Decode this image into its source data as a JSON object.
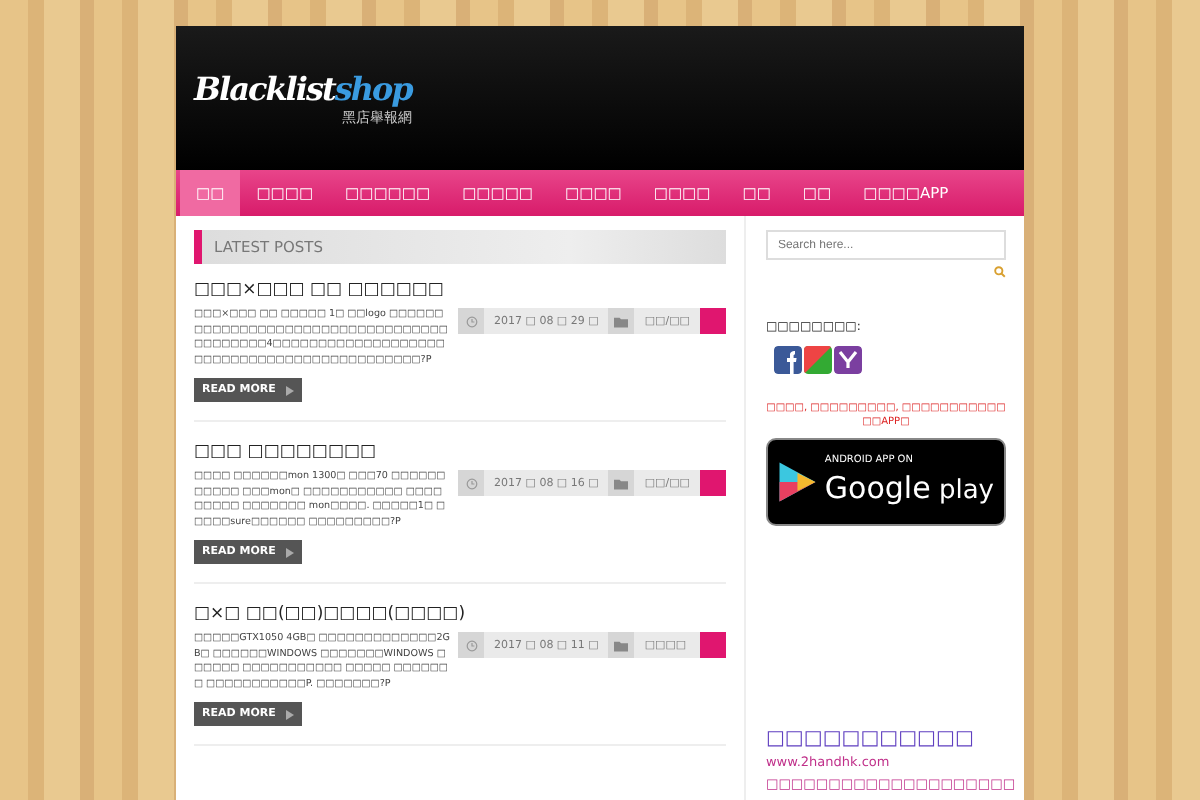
{
  "logo": {
    "main": "Blacklist",
    "accent": "shop",
    "subtitle": "黑店舉報網"
  },
  "nav": [
    {
      "label": "□□",
      "selected": true
    },
    {
      "label": "□□□□",
      "selected": false
    },
    {
      "label": "□□□□□□",
      "selected": false
    },
    {
      "label": "□□□□□",
      "selected": false
    },
    {
      "label": "□□□□",
      "selected": false
    },
    {
      "label": "□□□□",
      "selected": false
    },
    {
      "label": "□□",
      "selected": false
    },
    {
      "label": "□□",
      "selected": false
    },
    {
      "label": "□□□□APP",
      "selected": false
    }
  ],
  "section_title": "LATEST POSTS",
  "posts": [
    {
      "title": "□□□×□□□ □□ □□□□□□",
      "excerpt": "□□□×□□□ □□ □□□□□ 1□ □□logo □□□□□□□□□□□□□□□□□□□□□□□□□□□□□□□□□□□□□□□□□□4□□□□□□□□□□□□□□□□□□□□□□□□□□□□□□□□□□□□□□□□□□□□?P",
      "date": "2017 □ 08 □ 29 □",
      "category": "□□/□□",
      "read_more": "READ MORE"
    },
    {
      "title": "□□□ □□□□□□□□",
      "excerpt": "□□□□ □□□□□□mon 1300□ □□□70 □□□□□□□□□□□ □□□mon□ □□□□□□□□□□□ □□□□□□□□□ □□□□□□□ mon□□□□. □□□□□1□ □□□□□sure□□□□□□ □□□□□□□□□?P",
      "date": "2017 □ 08 □ 16 □",
      "category": "□□/□□",
      "read_more": "READ MORE"
    },
    {
      "title": "□×□ □□(□□)□□□□(□□□□)",
      "excerpt": "□□□□□GTX1050 4GB□ □□□□□□□□□□□□□2GB□ □□□□□□WINDOWS □□□□□□□WINDOWS □□□□□□ □□□□□□□□□□□ □□□□□ □□□□□□□ □□□□□□□□□□□P. □□□□□□□?P",
      "date": "2017 □ 08 □ 11 □",
      "category": "□□□□",
      "read_more": "READ MORE"
    }
  ],
  "sidebar": {
    "search_placeholder": "Search here...",
    "share_label": "□□□□□□□□:",
    "app_notice": "□□□□, □□□□□□□□□, □□□□□□□□□□□□□APP□",
    "badge_top": "ANDROID APP ON",
    "badge_brand": "Google",
    "badge_product": "play",
    "promo_title": "□□□□□□□□□□□",
    "promo_link": "www.2handhk.com",
    "promo_line": "□□□□□□□□□□□□□□□□□□□□"
  }
}
